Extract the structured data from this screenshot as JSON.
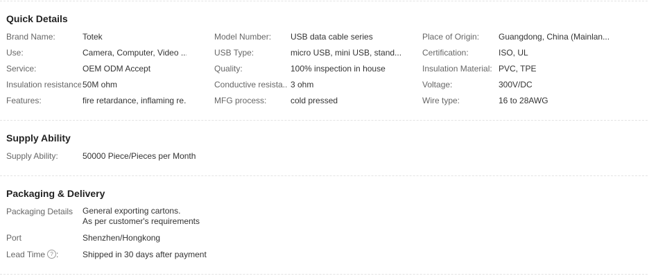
{
  "quick_details": {
    "title": "Quick Details",
    "rows": [
      [
        [
          "Brand Name:",
          "Totek"
        ],
        [
          "Model Number:",
          "USB data cable series"
        ],
        [
          "Place of Origin:",
          "Guangdong, China (Mainlan..."
        ]
      ],
      [
        [
          "Use:",
          "Camera, Computer, Video ..."
        ],
        [
          "USB Type:",
          "micro USB, mini USB, stand..."
        ],
        [
          "Certification:",
          "ISO, UL"
        ]
      ],
      [
        [
          "Service:",
          "OEM ODM Accept"
        ],
        [
          "Quality:",
          "100% inspection in house"
        ],
        [
          "Insulation Material:",
          "PVC, TPE"
        ]
      ],
      [
        [
          "Insulation resistance:",
          "50M ohm"
        ],
        [
          "Conductive resista...",
          "3 ohm"
        ],
        [
          "Voltage:",
          "300V/DC"
        ]
      ],
      [
        [
          "Features:",
          "fire retardance, inflaming re..."
        ],
        [
          "MFG process:",
          "cold pressed"
        ],
        [
          "Wire type:",
          "16 to 28AWG"
        ]
      ]
    ]
  },
  "supply_ability": {
    "title": "Supply Ability",
    "label": "Supply Ability:",
    "value": "50000 Piece/Pieces per Month"
  },
  "packaging_delivery": {
    "title": "Packaging & Delivery",
    "packaging_label": "Packaging Details",
    "packaging_line1": "General exporting cartons.",
    "packaging_line2": "As per customer's requirements",
    "port_label": "Port",
    "port_value": "Shenzhen/Hongkong",
    "lead_time_label": "Lead Time",
    "lead_time_suffix": ":",
    "lead_time_value": "Shipped in 30 days after payment",
    "help_icon": "?"
  }
}
